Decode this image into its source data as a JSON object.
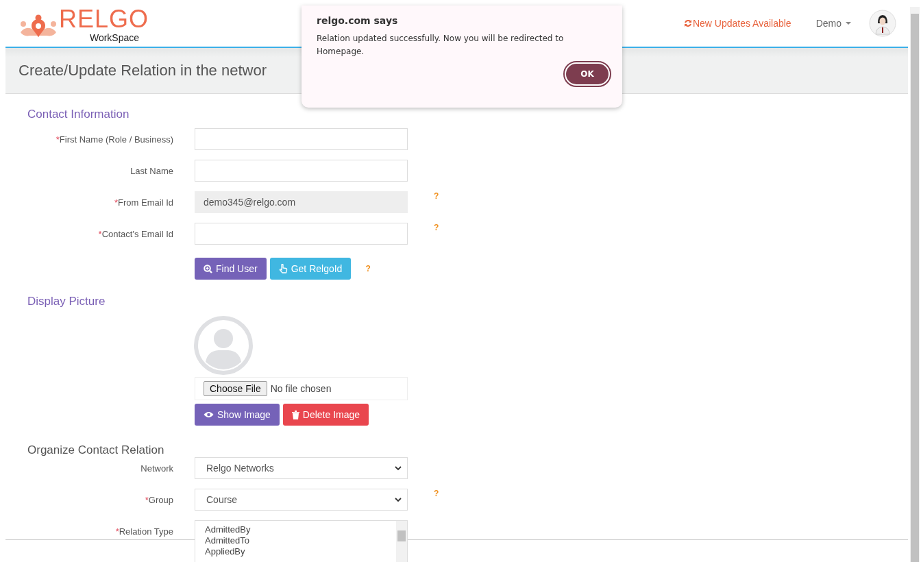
{
  "header": {
    "logo_title": "RELGO",
    "logo_subtitle": "WorkSpace",
    "updates_link": "New Updates Available",
    "user_menu": "Demo"
  },
  "page_title": "Create/Update Relation in the networ",
  "contact_section": {
    "heading": "Contact Information",
    "fields": [
      {
        "asterisk": "*",
        "label": "First Name (Role / Business)",
        "disabled": false
      },
      {
        "label": "Last Name",
        "disabled": false
      },
      {
        "asterisk": "*",
        "label": "From Email Id",
        "value": "demo345@relgo.com",
        "disabled": true,
        "help": "?"
      },
      {
        "asterisk": "*",
        "label": "Contact's Email Id",
        "disabled": false,
        "help": "?"
      }
    ],
    "buttons": [
      {
        "kind": "find",
        "label": "Find User"
      },
      {
        "kind": "relgoid",
        "label": "Get RelgoId"
      }
    ],
    "buttons_help": "?"
  },
  "picture_section": {
    "heading": "Display Picture",
    "file_input": {
      "button": "Choose File",
      "status": "No file chosen"
    },
    "buttons": [
      {
        "kind": "show",
        "label": "Show Image"
      },
      {
        "kind": "delete",
        "label": "Delete Image"
      }
    ]
  },
  "organize_section": {
    "heading": "Organize Contact Relation",
    "selects": [
      {
        "label": "Network",
        "value": "Relgo Networks"
      },
      {
        "asterisk": "*",
        "label": "Group",
        "value": "Course",
        "help": "?"
      }
    ],
    "relation_type": {
      "asterisk": "*",
      "label": "Relation Type",
      "options": [
        {
          "label": "AdmittedBy",
          "selected": false
        },
        {
          "label": "AdmittedTo",
          "selected": false
        },
        {
          "label": "AppliedBy",
          "selected": false
        }
      ]
    }
  },
  "dialog": {
    "title": "relgo.com says",
    "message": "Relation updated successfully. Now you will be redirected to Homepage.",
    "button": "OK"
  }
}
